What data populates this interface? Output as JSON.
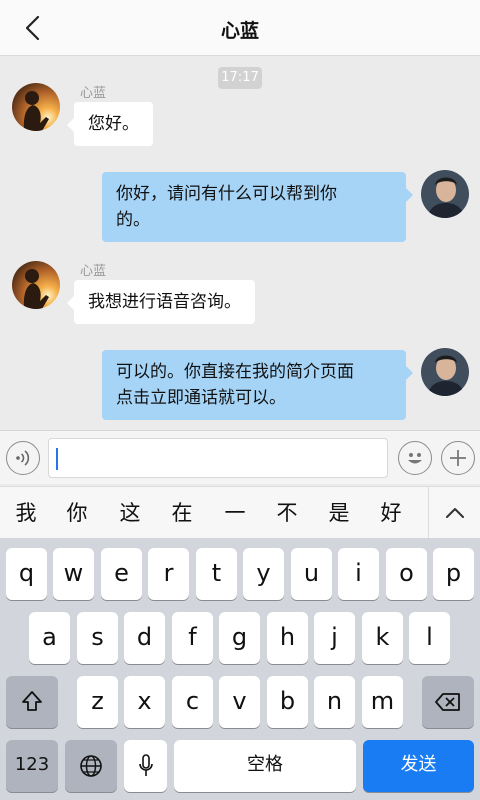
{
  "header": {
    "title": "心蓝",
    "back_icon": "back-arrow-icon"
  },
  "chat": {
    "timestamp": "17:17",
    "messages": [
      {
        "direction": "in",
        "sender": "心蓝",
        "lines": [
          "您好。"
        ]
      },
      {
        "direction": "out",
        "lines": [
          "你好，请问有什么可以帮到你",
          "的。"
        ]
      },
      {
        "direction": "in",
        "sender": "心蓝",
        "lines": [
          "我想进行语音咨询。"
        ]
      },
      {
        "direction": "out",
        "lines": [
          "可以的。你直接在我的简介页面",
          "点击立即通话就可以。"
        ]
      }
    ]
  },
  "input_bar": {
    "voice_icon": "voice-input-icon",
    "emoji_icon": "emoji-icon",
    "plus_icon": "plus-icon",
    "value": ""
  },
  "suggestions": {
    "items": [
      "我",
      "你",
      "这",
      "在",
      "一",
      "不",
      "是",
      "好"
    ],
    "collapse_icon": "chevron-up-icon"
  },
  "keyboard": {
    "row1": [
      "q",
      "w",
      "e",
      "r",
      "t",
      "y",
      "u",
      "i",
      "o",
      "p"
    ],
    "row2": [
      "a",
      "s",
      "d",
      "f",
      "g",
      "h",
      "j",
      "k",
      "l"
    ],
    "row3": [
      "z",
      "x",
      "c",
      "v",
      "b",
      "n",
      "m"
    ],
    "shift_icon": "shift-icon",
    "backspace_icon": "backspace-icon",
    "numbers_label": "123",
    "globe_icon": "globe-icon",
    "mic_icon": "microphone-icon",
    "space_label": "空格",
    "send_label": "发送"
  },
  "colors": {
    "outgoing_bubble": "#a6d4f7",
    "send_key": "#1a7cf2",
    "caret": "#2a73e8"
  }
}
